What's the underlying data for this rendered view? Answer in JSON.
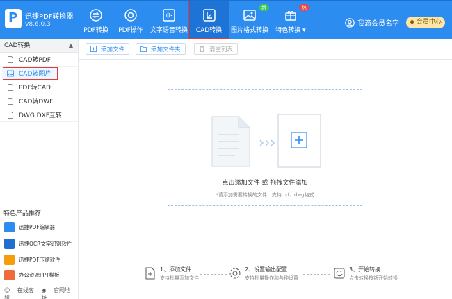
{
  "app": {
    "name": "迅捷PDF转换器",
    "version": "v8.6.0.3"
  },
  "nav": [
    {
      "label": "PDF转换",
      "icon": "convert-icon"
    },
    {
      "label": "PDF操作",
      "icon": "target-icon"
    },
    {
      "label": "文字语音转换",
      "icon": "audio-wave-icon"
    },
    {
      "label": "CAD转换",
      "icon": "cad-icon",
      "active": true
    },
    {
      "label": "图片格式转换",
      "icon": "image-icon",
      "badge": "新"
    },
    {
      "label": "特色转换 ▾",
      "icon": "gift-icon",
      "badge": "热"
    }
  ],
  "user": {
    "name": "我滴会员名字",
    "vip_label": "会员中心"
  },
  "sidebar": {
    "section": "CAD转换",
    "items": [
      {
        "label": "CAD转PDF"
      },
      {
        "label": "CAD转图片",
        "active": true
      },
      {
        "label": "PDF转CAD"
      },
      {
        "label": "CAD转DWF"
      },
      {
        "label": "DWG DXF互转"
      }
    ],
    "featured_title": "特色产品推荐",
    "featured": [
      {
        "label": "迅捷PDF编辑器",
        "color": "#2d8cf0"
      },
      {
        "label": "迅捷OCR文字识别软件",
        "color": "#1f6fd1"
      },
      {
        "label": "迅捷PDF压缩软件",
        "color": "#f59e0b"
      },
      {
        "label": "办公资源PPT模板",
        "color": "#ef6c3a"
      }
    ],
    "footer": {
      "support": "在线客服",
      "website": "官网地址"
    }
  },
  "toolbar": {
    "add_file": "添加文件",
    "add_folder": "添加文件夹",
    "clear_list": "清空列表"
  },
  "dropzone": {
    "title": "点击添加文件 或 拖拽文件添加",
    "hint": "*请添加需要转换的文件，支持dxf、dwg格式"
  },
  "steps": [
    {
      "title": "1、添加文件",
      "sub": "支持批量添加文件"
    },
    {
      "title": "2、设置输出配置",
      "sub": "支持批量操作和各种设置"
    },
    {
      "title": "3、开始转换",
      "sub": "点击转换按钮开始转换"
    }
  ],
  "colors": {
    "primary": "#2d8cf0",
    "highlight": "#e03b3b"
  }
}
